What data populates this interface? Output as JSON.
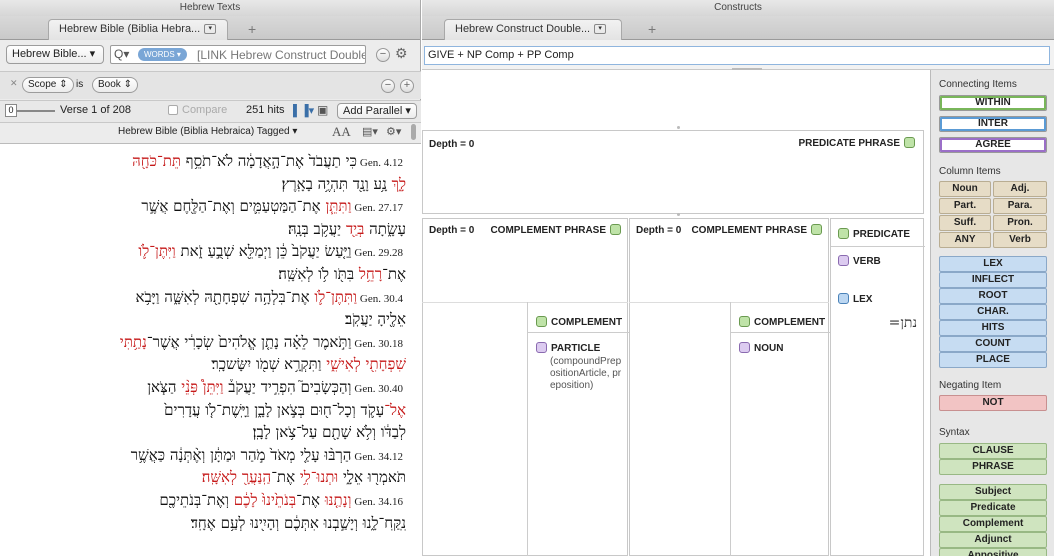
{
  "left": {
    "window_title": "Hebrew Texts",
    "tab_label": "Hebrew Bible (Biblia Hebra...",
    "resource_select": "Hebrew Bible...",
    "words_badge": "WORDS",
    "search_text": "[LINK Hebrew Construct Double",
    "scope": {
      "scope_label": "Scope",
      "is_label": "is",
      "book_label": "Book"
    },
    "verse_info": "Verse 1 of 208",
    "slider_value": "0",
    "compare_label": "Compare",
    "hits": "251 hits",
    "add_parallel": "Add Parallel",
    "resource_title": "Hebrew Bible (Biblia Hebraica) Tagged",
    "font_size_label": "AA",
    "verses": [
      {
        "ref": "Gen. 4.12",
        "pre": "כִּי תַעֲבֹד֙ אֶת־הָ֣אֲדָמָ֔ה לֹא־תֹסֵ֥ף ",
        "hl": "תֵּת־כֹּחָ֖הּ"
      },
      {
        "ref": "",
        "pre": "",
        "hl": "לָ֑ךְ",
        "post": " נָ֥ע וָנָ֖ד תִּהְיֶ֥ה בָאָֽרֶץ׃"
      },
      {
        "ref": "Gen. 27.17",
        "pre": "",
        "hl": "וַתִּתֵּ֧ן",
        "post": " אֶת־הַמַּטְעַמִּ֛ים וְאֶת־הַלֶּ֖חֶם אֲשֶׁ֣ר"
      },
      {
        "ref": "",
        "pre": "עָשָׂ֑תָה ",
        "hl": "בְּיַ֖ד",
        "post": " יַעֲקֹ֥ב בְּנָֽהּ׃"
      },
      {
        "ref": "Gen. 29.28",
        "pre": "וַיַּ֤עַשׂ יַעֲקֹב֙ כֵּ֔ן וַיְמַלֵּ֖א שְׁבֻ֣עַ זֹ֑את ",
        "hl": "וַיִּתֶּן־לֹ֛ו"
      },
      {
        "ref": "",
        "pre": "אֶת־",
        "hl": "רָחֵ֥ל",
        "post": " בִּתֹּ֖ו לֹ֥ו לְאִשָּֽׁה׃"
      },
      {
        "ref": "Gen. 30.4",
        "pre": "",
        "hl": "וַתִּתֶּן־לֹ֛ו",
        "post": " אֶת־בִּלְהָ֥ה שִׁפְחָתָ֖הּ לְאִשָּׁ֑ה וַיָּבֹ֥א"
      },
      {
        "ref": "",
        "pre": "אֵלֶ֖יהָ יַעֲקֹֽב׃"
      },
      {
        "ref": "Gen. 30.18",
        "pre": "וַתֹּ֣אמֶר לֵאָ֗ה נָתַ֤ן אֱלֹהִים֙ שְׂכָרִ֔י אֲשֶׁר־",
        "hl": "נָתַ֥תִּי"
      },
      {
        "ref": "",
        "pre": "",
        "hl": "שִׁפְחָתִ֖י לְאִישִׁ֑י",
        "post": " וַתִּקְרָ֥א שְׁמֹ֖ו יִשָּׂשכָֽר׃"
      },
      {
        "ref": "Gen. 30.40",
        "pre": "וְהַכְּשָׂבִים֮ הִפְרִ֣יד יַעֲקֹב֒ ",
        "hl": "וַיִּתֵּן֩ פְּנֵ֨י",
        "post": " הַצֹּ֧אן"
      },
      {
        "ref": "",
        "pre": "",
        "hl": "אֶל־",
        "post": "עָקֹ֛ד וְכָל־ח֖וּם בְּצֹ֣אן לָבָ֑ן וַיָּֽשֶׁת־לֹ֤ו עֲדָרִים֙"
      },
      {
        "ref": "",
        "pre": "לְבַדֹּ֔ו וְלֹ֥א שָׁתָ֖ם עַל־צֹ֥אן לָבָֽן׃"
      },
      {
        "ref": "Gen. 34.12",
        "pre": "הַרְבּ֨וּ עָלַ֤י מְאֹד֙ מֹ֣הַר וּמַתָּ֔ן וְאֶ֨תְּנָ֔ה כַּאֲשֶׁ֥ר"
      },
      {
        "ref": "",
        "pre": "תֹּאמְר֖וּ אֵלָ֑י ",
        "hl": "וּתְנוּ־לִ֥י",
        "post": " אֶת־",
        "hl2": "הַֽנַּעֲרָ֖ לְאִשָּֽׁה׃"
      },
      {
        "ref": "Gen. 34.16",
        "pre": "",
        "hl": "וְנָתַ֤נּוּ",
        "post": " אֶת־",
        "hl2": "בְּנֹתֵ֙ינוּ֙ לָכֶ֔ם",
        "post2": " וְאֶת־בְּנֹתֵיכֶ֖ם"
      },
      {
        "ref": "",
        "pre": "נִֽקַּֽח־לָ֑נוּ וְיָשַׁ֣בְנוּ אִתְּכֶ֔ם וְהָיִ֖ינוּ לְעַ֥ם אֶחָֽד׃"
      }
    ]
  },
  "right": {
    "window_title": "Constructs",
    "tab_label": "Hebrew Construct Double...",
    "construct_name": "GIVE + NP Comp + PP Comp",
    "cells": {
      "depth_label": "Depth = 0",
      "predicate_phrase": "PREDICATE PHRASE",
      "complement_phrase": "COMPLEMENT PHRASE",
      "predicate": "PREDICATE",
      "verb": "VERB",
      "lex": "LEX",
      "lex_value": "נתן=",
      "complement": "COMPLEMENT",
      "particle": "PARTICLE",
      "particle_detail": "(compoundPrepositionArticle, preposition)",
      "noun": "NOUN"
    },
    "palette": {
      "connecting_title": "Connecting Items",
      "connecting": [
        "WITHIN",
        "INTER",
        "AGREE"
      ],
      "column_title": "Column Items",
      "column": [
        [
          "Noun",
          "Adj."
        ],
        [
          "Part.",
          "Para."
        ],
        [
          "Suff.",
          "Pron."
        ],
        [
          "ANY",
          "Verb"
        ]
      ],
      "props": [
        "LEX",
        "INFLECT",
        "ROOT",
        "CHAR.",
        "HITS",
        "COUNT",
        "PLACE"
      ],
      "negating_title": "Negating Item",
      "negating": "NOT",
      "syntax_title": "Syntax",
      "syntax1": [
        "CLAUSE",
        "PHRASE"
      ],
      "syntax2": [
        "Subject",
        "Predicate",
        "Complement",
        "Adjunct",
        "Appositive"
      ]
    }
  }
}
